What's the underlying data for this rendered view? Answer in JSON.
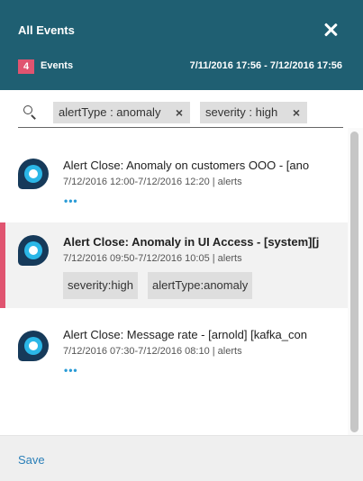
{
  "header": {
    "title": "All Events",
    "count": "4",
    "count_label": "Events",
    "time_range": "7/11/2016 17:56 - 7/12/2016 17:56"
  },
  "filters": [
    {
      "label": "alertType : anomaly",
      "remove": "×"
    },
    {
      "label": "severity : high",
      "remove": "×"
    }
  ],
  "events": [
    {
      "title": "Alert Close: Anomaly on customers OOO - [ano",
      "meta": "7/12/2016 12:00-7/12/2016 12:20 | alerts",
      "more": "•••"
    },
    {
      "title": "Alert Close: Anomaly in UI Access - [system][j",
      "meta": "7/12/2016 09:50-7/12/2016 10:05 | alerts",
      "tags": [
        "severity:high",
        "alertType:anomaly"
      ]
    },
    {
      "title": "Alert Close: Message rate - [arnold] [kafka_con",
      "meta": "7/12/2016 07:30-7/12/2016 08:10 | alerts",
      "more": "•••"
    }
  ],
  "footer": {
    "save_label": "Save"
  },
  "colors": {
    "header_bg": "#1f5f72",
    "accent": "#e05470",
    "link": "#2a7fb8"
  }
}
